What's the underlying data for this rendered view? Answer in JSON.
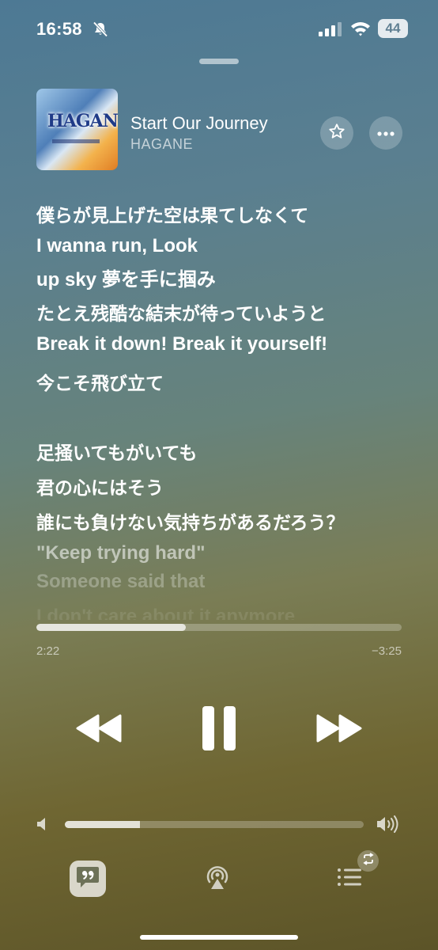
{
  "status_bar": {
    "time": "16:58",
    "battery": "44"
  },
  "now_playing": {
    "title": "Start Our Journey",
    "artist": "HAGANE",
    "artwork_text": "HAGANE"
  },
  "lyrics": [
    "僕らが見上げた空は果てしなくて",
    "I wanna run, Look",
    "up sky 夢を手に掴み",
    "たとえ残酷な結末が待っていようと",
    "Break it down! Break it yourself!",
    "今こそ飛び立て",
    "足掻いてもがいても",
    "君の心にはそう",
    "誰にも負けない気持ちがあるだろう？",
    "\"Keep trying hard\"",
    "Someone said that",
    "I don't care about it anymore"
  ],
  "playback": {
    "elapsed": "2:22",
    "remaining": "−3:25",
    "progress_fraction": 0.41
  },
  "volume": {
    "level_fraction": 0.25
  },
  "icons": {
    "bell": "bell-slash-icon",
    "star": "star-icon",
    "more": "ellipsis-icon",
    "rewind": "backward-icon",
    "pause": "pause-icon",
    "forward": "forward-icon",
    "lyrics": "quote-bubble-icon",
    "airplay": "airplay-icon",
    "queue": "list-icon",
    "repeat": "repeat-icon"
  }
}
